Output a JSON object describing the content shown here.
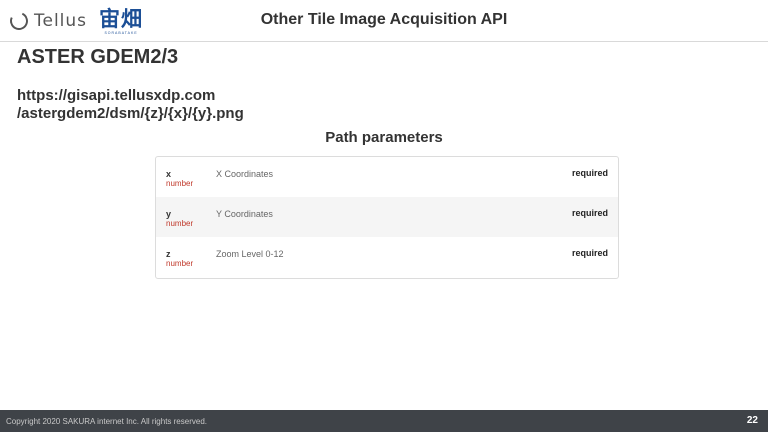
{
  "header": {
    "logo_text": "Tellus",
    "logo_mark": "宙畑",
    "logo_mark_sub": "SORABATAKE",
    "title": "Other Tile Image Acquisition API"
  },
  "section": {
    "title": "ASTER GDEM2/3",
    "url_line1": "https://gisapi.tellusxdp.com",
    "url_line2": "/astergdem2/dsm/{z}/{x}/{y}.png"
  },
  "params": {
    "heading": "Path parameters",
    "rows": [
      {
        "name": "x",
        "type": "number",
        "description": "X Coordinates",
        "required": "required"
      },
      {
        "name": "y",
        "type": "number",
        "description": "Y Coordinates",
        "required": "required"
      },
      {
        "name": "z",
        "type": "number",
        "description": "Zoom Level 0-12",
        "required": "required"
      }
    ]
  },
  "footer": {
    "copyright": "Copyright 2020 SAKURA internet Inc. All rights reserved.",
    "page_number": "22"
  }
}
